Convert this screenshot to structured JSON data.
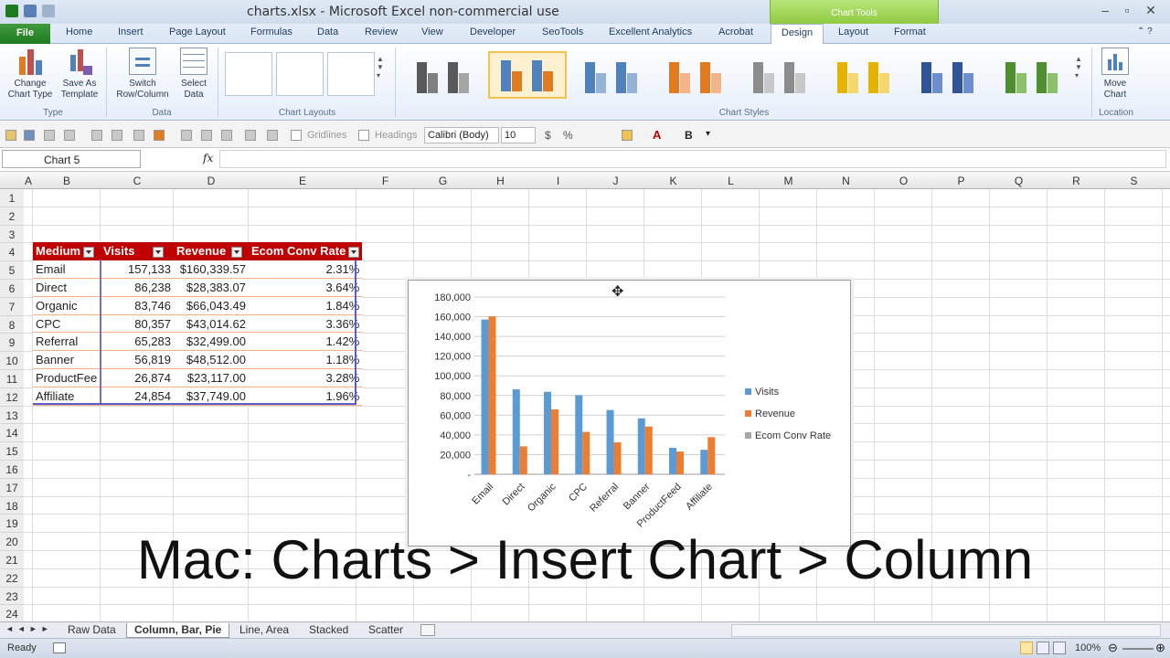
{
  "window": {
    "title": "charts.xlsx  -  Microsoft Excel non-commercial use",
    "context_tab": "Chart Tools"
  },
  "tabs": [
    "File",
    "Home",
    "Insert",
    "Page Layout",
    "Formulas",
    "Data",
    "Review",
    "View",
    "Developer",
    "SeoTools",
    "Excellent Analytics",
    "Acrobat",
    "Design",
    "Layout",
    "Format"
  ],
  "ribbon": {
    "change_chart_type": "Change\nChart Type",
    "save_as_template": "Save As\nTemplate",
    "group_type": "Type",
    "switch_row_column": "Switch\nRow/Column",
    "select_data": "Select\nData",
    "group_data": "Data",
    "group_chart_layouts": "Chart Layouts",
    "group_chart_styles": "Chart Styles",
    "move_chart": "Move\nChart",
    "group_location": "Location"
  },
  "format_bar": {
    "gridlines": "Gridlines",
    "headings": "Headings",
    "font": "Calibri (Body)",
    "size": "10",
    "currency": "$",
    "percent": "%",
    "bold": "B"
  },
  "formula_bar": {
    "name_box": "Chart 5",
    "fx": "fx"
  },
  "columns": [
    "A",
    "B",
    "C",
    "D",
    "E",
    "F",
    "G",
    "H",
    "I",
    "J",
    "K",
    "L",
    "M",
    "N",
    "O",
    "P",
    "Q",
    "R",
    "S"
  ],
  "rows": [
    "1",
    "2",
    "3",
    "4",
    "5",
    "6",
    "7",
    "8",
    "9",
    "10",
    "11",
    "12",
    "13",
    "14",
    "15",
    "16",
    "17",
    "18",
    "19",
    "20",
    "21",
    "22",
    "23",
    "24"
  ],
  "table": {
    "headers": [
      "Medium",
      "Visits",
      "Revenue",
      "Ecom Conv Rate"
    ],
    "rows": [
      [
        "Email",
        "157,133",
        "$160,339.57",
        "2.31%"
      ],
      [
        "Direct",
        "86,238",
        "$28,383.07",
        "3.64%"
      ],
      [
        "Organic",
        "83,746",
        "$66,043.49",
        "1.84%"
      ],
      [
        "CPC",
        "80,357",
        "$43,014.62",
        "3.36%"
      ],
      [
        "Referral",
        "65,283",
        "$32,499.00",
        "1.42%"
      ],
      [
        "Banner",
        "56,819",
        "$48,512.00",
        "1.18%"
      ],
      [
        "ProductFee",
        "26,874",
        "$23,117.00",
        "3.28%"
      ],
      [
        "Affiliate",
        "24,854",
        "$37,749.00",
        "1.96%"
      ]
    ]
  },
  "chart_data": {
    "type": "bar",
    "categories": [
      "Email",
      "Direct",
      "Organic",
      "CPC",
      "Referral",
      "Banner",
      "ProductFeed",
      "Affiliate"
    ],
    "series": [
      {
        "name": "Visits",
        "values": [
          157133,
          86238,
          83746,
          80357,
          65283,
          56819,
          26874,
          24854
        ],
        "color": "#5b9bd5"
      },
      {
        "name": "Revenue",
        "values": [
          160339.57,
          28383.07,
          66043.49,
          43014.62,
          32499,
          48512,
          23117,
          37749
        ],
        "color": "#ed7d31"
      },
      {
        "name": "Ecom Conv Rate",
        "values": [
          2.31,
          3.64,
          1.84,
          3.36,
          1.42,
          1.18,
          3.28,
          1.96
        ],
        "color": "#a5a5a5"
      }
    ],
    "yticks": [
      "-",
      "20,000",
      "40,000",
      "60,000",
      "80,000",
      "100,000",
      "120,000",
      "140,000",
      "160,000",
      "180,000"
    ],
    "ylim": [
      0,
      180000
    ],
    "grid": true,
    "legend": "right"
  },
  "caption": "Mac: Charts > Insert Chart > Column",
  "sheet_tabs": [
    "Raw Data",
    "Column, Bar, Pie",
    "Line, Area",
    "Stacked",
    "Scatter"
  ],
  "status": {
    "ready": "Ready",
    "zoom": "100%"
  }
}
